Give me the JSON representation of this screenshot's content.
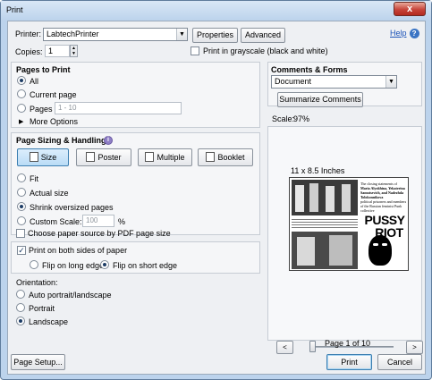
{
  "window": {
    "title": "Print",
    "close_glyph": "x"
  },
  "printer": {
    "label": "Printer:",
    "value": "LabtechPrinter",
    "properties_label": "Properties",
    "advanced_label": "Advanced",
    "help_label": "Help"
  },
  "copies": {
    "label": "Copies:",
    "value": "1",
    "grayscale_label": "Print in grayscale (black and white)"
  },
  "pages_to_print": {
    "title": "Pages to Print",
    "all_label": "All",
    "current_label": "Current page",
    "pages_label": "Pages",
    "pages_value": "1 - 10",
    "more_options_label": "More Options"
  },
  "sizing": {
    "title": "Page Sizing & Handling",
    "tabs": [
      "Size",
      "Poster",
      "Multiple",
      "Booklet"
    ],
    "fit_label": "Fit",
    "actual_label": "Actual size",
    "shrink_label": "Shrink oversized pages",
    "custom_label": "Custom Scale:",
    "custom_value": "100",
    "custom_unit": "%",
    "paper_source_label": "Choose paper source by PDF page size"
  },
  "duplex": {
    "both_sides_label": "Print on both sides of paper",
    "long_edge_label": "Flip on long edge",
    "short_edge_label": "Flip on short edge"
  },
  "orientation": {
    "title": "Orientation:",
    "auto_label": "Auto portrait/landscape",
    "portrait_label": "Portrait",
    "landscape_label": "Landscape"
  },
  "comments": {
    "title": "Comments & Forms",
    "value": "Document",
    "summarize_label": "Summarize Comments",
    "scale_label": "Scale:",
    "scale_value": "97%"
  },
  "preview": {
    "paper_size": "11 x 8.5 Inches",
    "page_label": "Page 1 of 10",
    "slider_position": 0.0,
    "doc_heading": "The closing statements of",
    "doc_names": "Maria Alyokhina, Yekaterina Samutsevich, and Nadezhda Tolokonnikova",
    "doc_sub": "political prisoners and members of the Russian feminist Punk collective",
    "logo_line1": "PUSSY",
    "logo_line2": "RIOT",
    "prev_glyph": "<",
    "next_glyph": ">"
  },
  "footer": {
    "page_setup_label": "Page Setup...",
    "print_label": "Print",
    "cancel_label": "Cancel"
  }
}
